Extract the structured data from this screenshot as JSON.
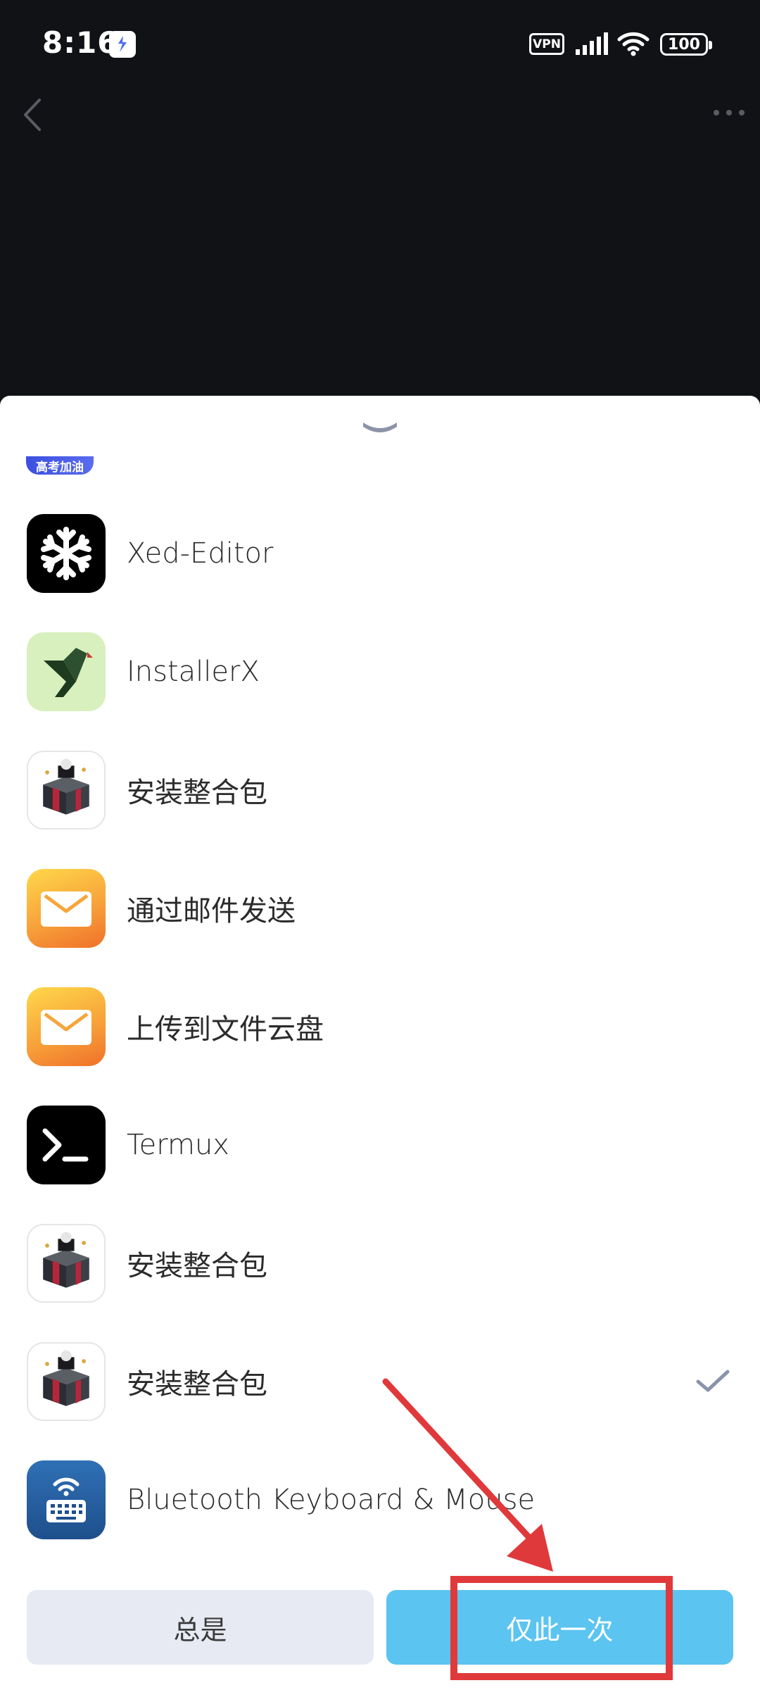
{
  "status_bar": {
    "time": "8:16",
    "vpn_label": "VPN",
    "battery_level": "100",
    "icons": [
      "app-notification-icon",
      "signal-icon",
      "wifi-icon",
      "battery-icon"
    ]
  },
  "nav": {
    "back_icon": "chevron-left-icon",
    "more_icon": "more-horizontal-icon"
  },
  "sheet": {
    "handle_icon": "chevron-down-icon",
    "badge_text": "高考加油",
    "apps": [
      {
        "label": "Xed-Editor",
        "icon": "snowflake-icon"
      },
      {
        "label": "InstallerX",
        "icon": "installerx-bird-icon"
      },
      {
        "label": "安装整合包",
        "icon": "gift-box-icon"
      },
      {
        "label": "通过邮件发送",
        "icon": "mail-icon"
      },
      {
        "label": "上传到文件云盘",
        "icon": "mail-icon"
      },
      {
        "label": "Termux",
        "icon": "terminal-icon"
      },
      {
        "label": "安装整合包",
        "icon": "gift-box-icon"
      },
      {
        "label": "安装整合包",
        "icon": "gift-box-icon",
        "selected": true
      },
      {
        "label": "Bluetooth Keyboard & Mouse",
        "icon": "bluetooth-keyboard-icon"
      }
    ],
    "always_label": "总是",
    "once_label": "仅此一次"
  },
  "colors": {
    "background_dark": "#111216",
    "sheet_bg": "#ffffff",
    "always_bg": "#e7eaf3",
    "once_bg": "#5bc4f0",
    "annotation": "#e0393b",
    "check": "#8a93aa"
  }
}
